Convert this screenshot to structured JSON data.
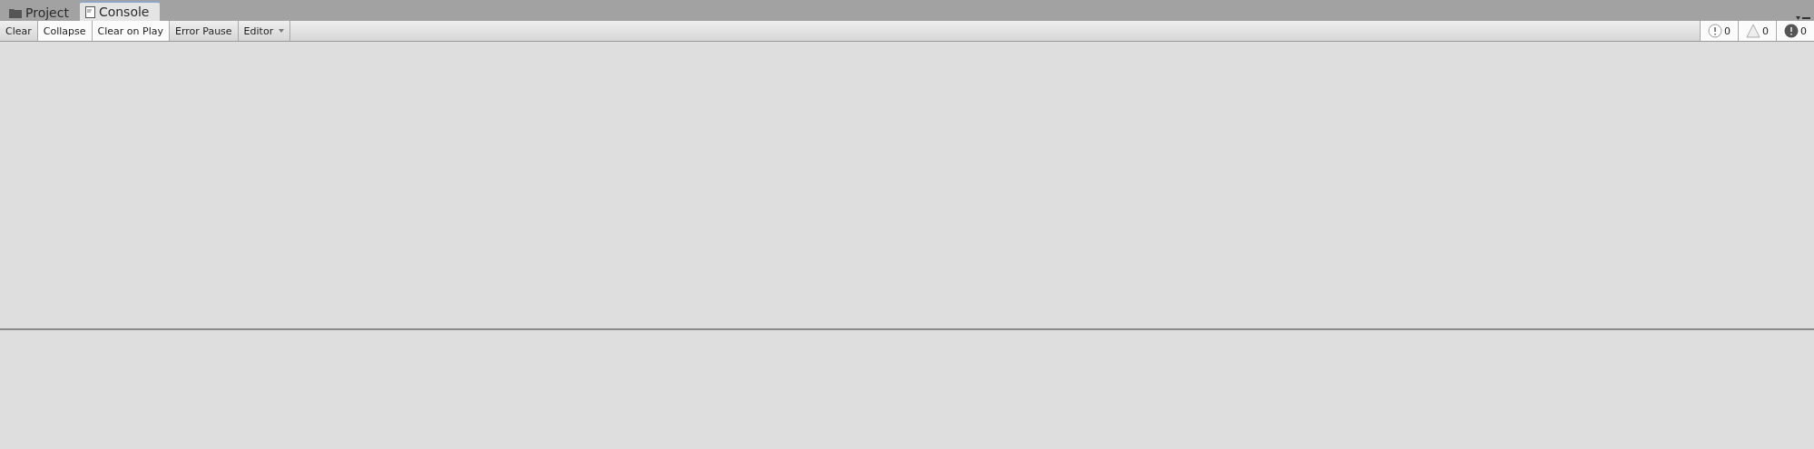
{
  "tabs": [
    {
      "label": "Project",
      "kind": "folder",
      "selected": false
    },
    {
      "label": "Console",
      "kind": "console",
      "selected": true
    }
  ],
  "toolbar": {
    "buttons": [
      {
        "label": "Clear",
        "kind": "button",
        "selected": false
      },
      {
        "label": "Collapse",
        "kind": "toggle",
        "selected": true
      },
      {
        "label": "Clear on Play",
        "kind": "toggle",
        "selected": true
      },
      {
        "label": "Error Pause",
        "kind": "toggle",
        "selected": false
      },
      {
        "label": "Editor",
        "kind": "dropdown",
        "selected": false
      }
    ],
    "counters": [
      {
        "kind": "info",
        "count": "0",
        "selected": true
      },
      {
        "kind": "warning",
        "count": "0",
        "selected": true
      },
      {
        "kind": "error",
        "count": "0",
        "selected": true
      }
    ]
  }
}
